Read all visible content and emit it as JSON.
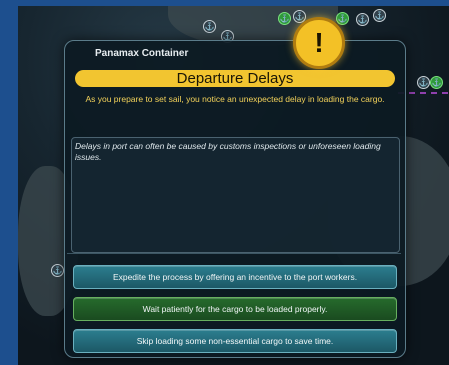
{
  "dialog": {
    "subtitle": "Panamax Container",
    "title": "Departure Delays",
    "alert_symbol": "!",
    "description": "As you prepare to set sail, you notice an unexpected delay in loading the cargo.",
    "info": "Delays in port can often be caused by customs inspections or unforeseen loading issues."
  },
  "choices": [
    {
      "label": "Expedite the process by offering an incentive to the port workers.",
      "style": "teal"
    },
    {
      "label": "Wait patiently for the cargo to be loaded properly.",
      "style": "green"
    },
    {
      "label": "Skip loading some non-essential cargo to save time.",
      "style": "teal"
    }
  ],
  "map": {
    "pin_symbol": "⚓",
    "pin_color": "#31404a",
    "pin_green_color": "#2f9a3a",
    "route_color": "#b04ad0"
  },
  "colors": {
    "frame_border": "#1d4f8e",
    "title_bar": "#f2c530",
    "description_text": "#f3d25a",
    "choice_teal": "#1c5866",
    "choice_green": "#1a4b20"
  }
}
